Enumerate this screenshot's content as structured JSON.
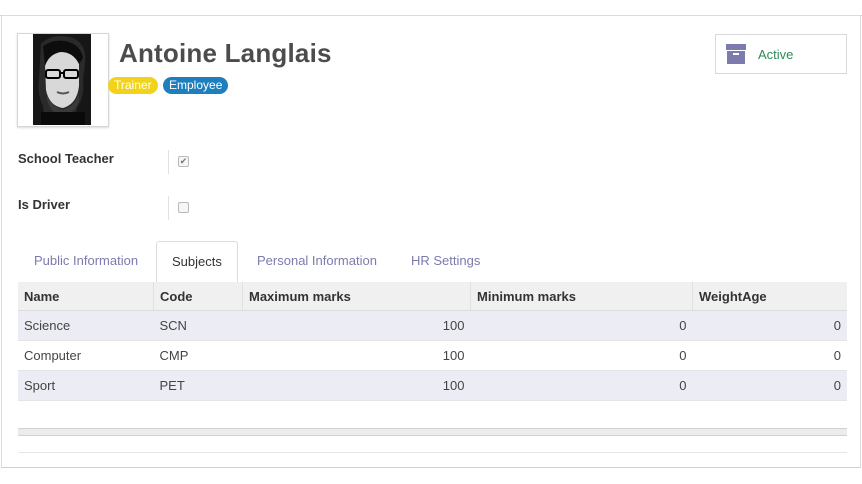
{
  "header": {
    "name": "Antoine Langlais",
    "tags": [
      {
        "label": "Trainer",
        "color": "#f2d31b"
      },
      {
        "label": "Employee",
        "color": "#1d7fbd"
      }
    ],
    "status_button": {
      "label": "Active",
      "icon": "archive-icon"
    }
  },
  "fields": {
    "school_teacher": {
      "label": "School Teacher",
      "checked": true
    },
    "is_driver": {
      "label": "Is Driver",
      "checked": false
    }
  },
  "tabs": [
    {
      "label": "Public Information",
      "active": false
    },
    {
      "label": "Subjects",
      "active": true
    },
    {
      "label": "Personal Information",
      "active": false
    },
    {
      "label": "HR Settings",
      "active": false
    }
  ],
  "table": {
    "columns": [
      "Name",
      "Code",
      "Maximum marks",
      "Minimum marks",
      "WeightAge"
    ],
    "rows": [
      {
        "name": "Science",
        "code": "SCN",
        "max": "100",
        "min": "0",
        "weight": "0"
      },
      {
        "name": "Computer",
        "code": "CMP",
        "max": "100",
        "min": "0",
        "weight": "0"
      },
      {
        "name": "Sport",
        "code": "PET",
        "max": "100",
        "min": "0",
        "weight": "0"
      }
    ]
  },
  "colors": {
    "accent": "#7c7bad",
    "active_text": "#2e8b57",
    "row_band": "#ececf4"
  }
}
